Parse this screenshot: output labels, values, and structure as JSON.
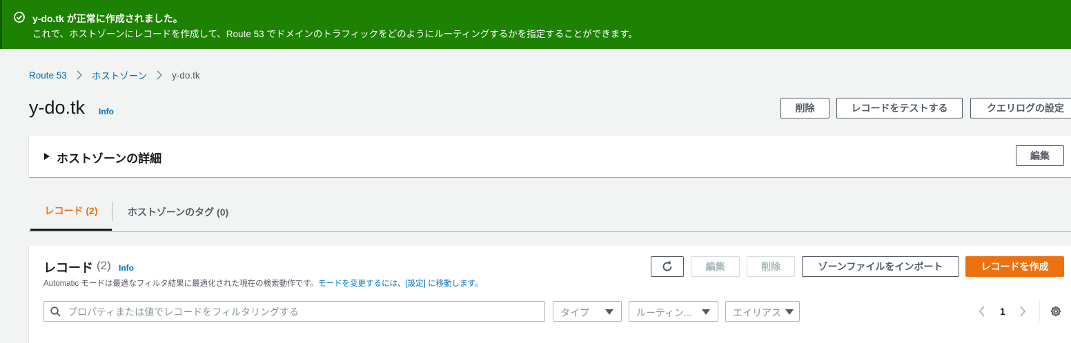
{
  "flash": {
    "title": "y-do.tk が正常に作成されました。",
    "message": "これで、ホストゾーンにレコードを作成して、Route 53 でドメインのトラフィックをどのようにルーティングするかを指定することができます。",
    "color": "#1d8102"
  },
  "breadcrumb": {
    "items": [
      "Route 53",
      "ホストゾーン"
    ],
    "current": "y-do.tk"
  },
  "page": {
    "title": "y-do.tk",
    "info": "Info",
    "buttons": {
      "delete": "削除",
      "test_record": "レコードをテストする",
      "query_log": "クエリログの設定"
    }
  },
  "details_panel": {
    "title": "ホストゾーンの詳細",
    "edit": "編集"
  },
  "tabs": [
    {
      "label": "レコード (2)",
      "active": true
    },
    {
      "label": "ホストゾーンのタグ (0)",
      "active": false
    }
  ],
  "records": {
    "title": "レコード",
    "count": "(2)",
    "info": "Info",
    "description": "Automatic モードは最適なフィルタ結果に最適化された現在の検索動作です。",
    "description_link": "モードを変更するには、[設定] に移動します。",
    "buttons": {
      "refresh_icon": "refresh-icon",
      "edit": "編集",
      "delete": "削除",
      "import_zone": "ゾーンファイルをインポート",
      "create": "レコードを作成"
    },
    "filter": {
      "placeholder": "プロパティまたは値でレコードをフィルタリングする",
      "value": ""
    },
    "selects": {
      "type": "タイプ",
      "routing": "ルーティン...",
      "alias": "エイリアス"
    },
    "pagination": {
      "page": "1"
    }
  },
  "colors": {
    "accent": "#ec7211",
    "link": "#0073bb",
    "success": "#1d8102"
  }
}
